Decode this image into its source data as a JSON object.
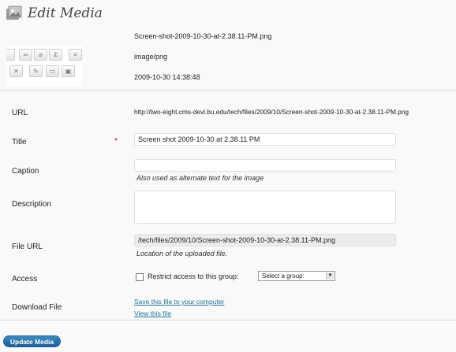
{
  "header": {
    "title": "Edit Media"
  },
  "file": {
    "name": "Screen-shot-2009-10-30-at-2.38.11-PM.png",
    "mime": "image/png",
    "date": "2009-10-30 14:38:48"
  },
  "fields": {
    "url_label": "URL",
    "url_value": "http://two-eight.cms-devl.bu.edu/tech/files/2009/10/Screen-shot-2009-10-30-at-2.38.11-PM.png",
    "title_label": "Title",
    "required_mark": "*",
    "title_value": "Screen shot 2009-10-30 at 2.38.11 PM",
    "caption_label": "Caption",
    "caption_value": "",
    "caption_help": "Also used as alternate text for the image",
    "description_label": "Description",
    "description_value": "",
    "file_url_label": "File URL",
    "file_url_value": "/tech/files/2009/10/Screen-shot-2009-10-30-at-2.38.11-PM.png",
    "file_url_help": "Location of the uploaded file.",
    "access_label": "Access",
    "access_text": "Restrict access to this group:",
    "access_select": "Select a group:",
    "download_label": "Download File",
    "download_link": "Save this file to your computer",
    "view_link": "View this file"
  },
  "actions": {
    "update_label": "Update Media"
  },
  "colors": {
    "link": "#21759b",
    "button": "#2a74a8",
    "required": "#dd0000"
  }
}
